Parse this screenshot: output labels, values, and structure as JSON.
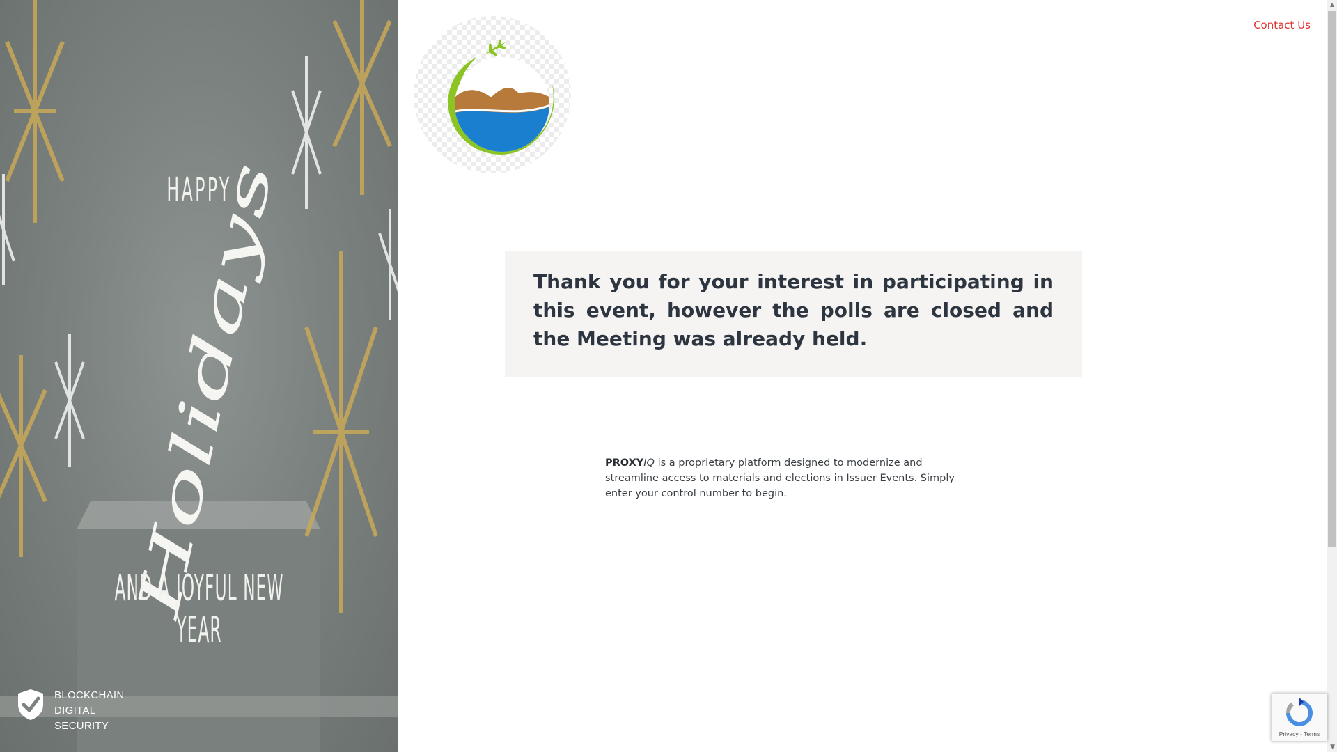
{
  "header": {
    "contact_label": "Contact Us"
  },
  "banner": {
    "happy_text": "HAPPY",
    "holidays_text": "Holidays",
    "newyear_text": "AND A JOYFUL NEW YEAR"
  },
  "badge": {
    "line1": "BLOCKCHAIN",
    "line2": "DIGITAL",
    "line3": "SECURITY"
  },
  "notice": {
    "message": "Thank you for your interest in participating in this event, however the polls are closed and the Meeting was already held."
  },
  "description": {
    "brand_bold": "PROXY",
    "brand_italic": "IQ",
    "text": " is a proprietary platform designed to modernize and streamline access to materials and elections in Issuer Events. Simply enter your control number to begin."
  },
  "recaptcha": {
    "privacy": "Privacy",
    "separator": " - ",
    "terms": "Terms"
  },
  "colors": {
    "contact": "#e0322f",
    "notice_bg": "#f5f4f2",
    "notice_text": "#2d3640",
    "logo_green": "#8cc425",
    "logo_brown": "#b87a3a",
    "logo_blue": "#1a7fcf"
  },
  "icons": {
    "badge": "shield-check-icon",
    "logo_plane": "airplane-icon",
    "recaptcha": "recaptcha-icon"
  }
}
